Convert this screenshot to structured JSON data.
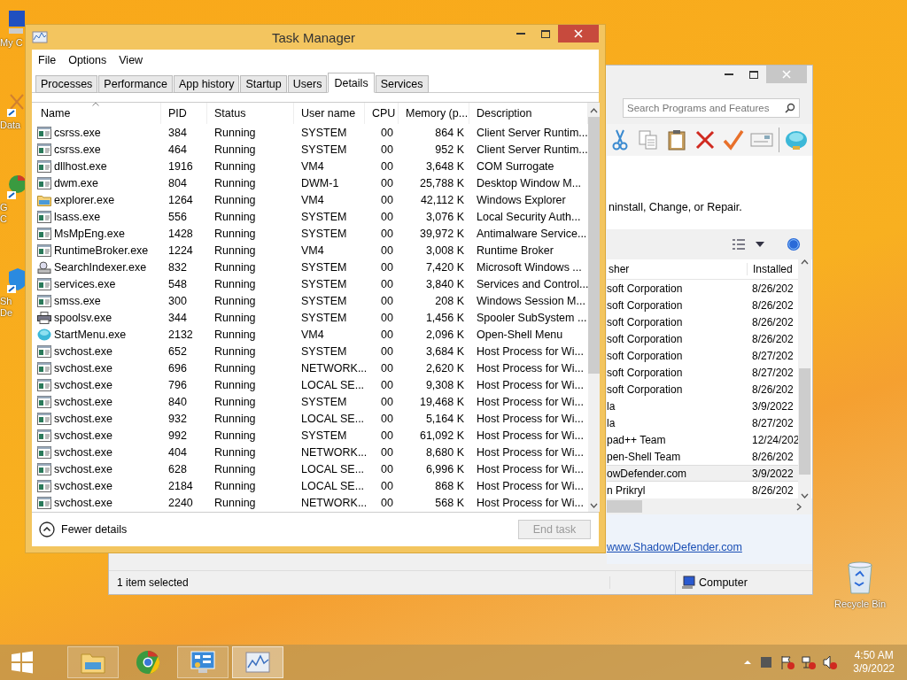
{
  "desktop_icons": [
    {
      "kind": "computer",
      "lines": [
        "My C"
      ]
    },
    {
      "kind": "shortcut",
      "lines": [
        "Data"
      ]
    },
    {
      "kind": "chrome",
      "lines": [
        "G",
        "C"
      ]
    },
    {
      "kind": "shield",
      "lines": [
        "Sh",
        "De"
      ]
    }
  ],
  "recycle_bin": {
    "label": "Recycle Bin"
  },
  "background_window": {
    "search": {
      "placeholder": "Search Programs and Features"
    },
    "instruction": "ninstall, Change, or Repair.",
    "columns": [
      "sher",
      "Installed"
    ],
    "rows": [
      {
        "publisher": "soft Corporation",
        "installed": "8/26/202",
        "selected": false
      },
      {
        "publisher": "soft Corporation",
        "installed": "8/26/202",
        "selected": false
      },
      {
        "publisher": "soft Corporation",
        "installed": "8/26/202",
        "selected": false
      },
      {
        "publisher": "soft Corporation",
        "installed": "8/26/202",
        "selected": false
      },
      {
        "publisher": "soft Corporation",
        "installed": "8/27/202",
        "selected": false
      },
      {
        "publisher": "soft Corporation",
        "installed": "8/27/202",
        "selected": false
      },
      {
        "publisher": "soft Corporation",
        "installed": "8/26/202",
        "selected": false
      },
      {
        "publisher": "la",
        "installed": "3/9/2022",
        "selected": false
      },
      {
        "publisher": "la",
        "installed": "8/27/202",
        "selected": false
      },
      {
        "publisher": "pad++ Team",
        "installed": "12/24/202",
        "selected": false
      },
      {
        "publisher": "pen-Shell Team",
        "installed": "8/26/202",
        "selected": false
      },
      {
        "publisher": "owDefender.com",
        "installed": "3/9/2022",
        "selected": true
      },
      {
        "publisher": "n Prikryl",
        "installed": "8/26/202",
        "selected": false
      }
    ],
    "link": "www.ShadowDefender.com",
    "status_bar": {
      "selection": "1 item selected",
      "location": "Computer"
    }
  },
  "task_manager": {
    "title": "Task Manager",
    "menu": [
      "File",
      "Options",
      "View"
    ],
    "tabs": [
      {
        "label": "Processes",
        "selected": false
      },
      {
        "label": "Performance",
        "selected": false
      },
      {
        "label": "App history",
        "selected": false
      },
      {
        "label": "Startup",
        "selected": false
      },
      {
        "label": "Users",
        "selected": false
      },
      {
        "label": "Details",
        "selected": true
      },
      {
        "label": "Services",
        "selected": false
      }
    ],
    "columns": [
      "Name",
      "PID",
      "Status",
      "User name",
      "CPU",
      "Memory (p...",
      "Description"
    ],
    "rows": [
      {
        "kind": "app",
        "name": "csrss.exe",
        "pid": "384",
        "status": "Running",
        "user": "SYSTEM",
        "cpu": "00",
        "memory": "864 K",
        "description": "Client Server Runtim..."
      },
      {
        "kind": "app",
        "name": "csrss.exe",
        "pid": "464",
        "status": "Running",
        "user": "SYSTEM",
        "cpu": "00",
        "memory": "952 K",
        "description": "Client Server Runtim..."
      },
      {
        "kind": "app",
        "name": "dllhost.exe",
        "pid": "1916",
        "status": "Running",
        "user": "VM4",
        "cpu": "00",
        "memory": "3,648 K",
        "description": "COM Surrogate"
      },
      {
        "kind": "app",
        "name": "dwm.exe",
        "pid": "804",
        "status": "Running",
        "user": "DWM-1",
        "cpu": "00",
        "memory": "25,788 K",
        "description": "Desktop Window M..."
      },
      {
        "kind": "folder",
        "name": "explorer.exe",
        "pid": "1264",
        "status": "Running",
        "user": "VM4",
        "cpu": "00",
        "memory": "42,112 K",
        "description": "Windows Explorer"
      },
      {
        "kind": "app",
        "name": "lsass.exe",
        "pid": "556",
        "status": "Running",
        "user": "SYSTEM",
        "cpu": "00",
        "memory": "3,076 K",
        "description": "Local Security Auth..."
      },
      {
        "kind": "app",
        "name": "MsMpEng.exe",
        "pid": "1428",
        "status": "Running",
        "user": "SYSTEM",
        "cpu": "00",
        "memory": "39,972 K",
        "description": "Antimalware Service..."
      },
      {
        "kind": "app",
        "name": "RuntimeBroker.exe",
        "pid": "1224",
        "status": "Running",
        "user": "VM4",
        "cpu": "00",
        "memory": "3,008 K",
        "description": "Runtime Broker"
      },
      {
        "kind": "search",
        "name": "SearchIndexer.exe",
        "pid": "832",
        "status": "Running",
        "user": "SYSTEM",
        "cpu": "00",
        "memory": "7,420 K",
        "description": "Microsoft Windows ..."
      },
      {
        "kind": "app",
        "name": "services.exe",
        "pid": "548",
        "status": "Running",
        "user": "SYSTEM",
        "cpu": "00",
        "memory": "3,840 K",
        "description": "Services and Control..."
      },
      {
        "kind": "app",
        "name": "smss.exe",
        "pid": "300",
        "status": "Running",
        "user": "SYSTEM",
        "cpu": "00",
        "memory": "208 K",
        "description": "Windows Session M..."
      },
      {
        "kind": "printer",
        "name": "spoolsv.exe",
        "pid": "344",
        "status": "Running",
        "user": "SYSTEM",
        "cpu": "00",
        "memory": "1,456 K",
        "description": "Spooler SubSystem ..."
      },
      {
        "kind": "shell",
        "name": "StartMenu.exe",
        "pid": "2132",
        "status": "Running",
        "user": "VM4",
        "cpu": "00",
        "memory": "2,096 K",
        "description": "Open-Shell Menu"
      },
      {
        "kind": "app",
        "name": "svchost.exe",
        "pid": "652",
        "status": "Running",
        "user": "SYSTEM",
        "cpu": "00",
        "memory": "3,684 K",
        "description": "Host Process for Wi..."
      },
      {
        "kind": "app",
        "name": "svchost.exe",
        "pid": "696",
        "status": "Running",
        "user": "NETWORK...",
        "cpu": "00",
        "memory": "2,620 K",
        "description": "Host Process for Wi..."
      },
      {
        "kind": "app",
        "name": "svchost.exe",
        "pid": "796",
        "status": "Running",
        "user": "LOCAL SE...",
        "cpu": "00",
        "memory": "9,308 K",
        "description": "Host Process for Wi..."
      },
      {
        "kind": "app",
        "name": "svchost.exe",
        "pid": "840",
        "status": "Running",
        "user": "SYSTEM",
        "cpu": "00",
        "memory": "19,468 K",
        "description": "Host Process for Wi..."
      },
      {
        "kind": "app",
        "name": "svchost.exe",
        "pid": "932",
        "status": "Running",
        "user": "LOCAL SE...",
        "cpu": "00",
        "memory": "5,164 K",
        "description": "Host Process for Wi..."
      },
      {
        "kind": "app",
        "name": "svchost.exe",
        "pid": "992",
        "status": "Running",
        "user": "SYSTEM",
        "cpu": "00",
        "memory": "61,092 K",
        "description": "Host Process for Wi..."
      },
      {
        "kind": "app",
        "name": "svchost.exe",
        "pid": "404",
        "status": "Running",
        "user": "NETWORK...",
        "cpu": "00",
        "memory": "8,680 K",
        "description": "Host Process for Wi..."
      },
      {
        "kind": "app",
        "name": "svchost.exe",
        "pid": "628",
        "status": "Running",
        "user": "LOCAL SE...",
        "cpu": "00",
        "memory": "6,996 K",
        "description": "Host Process for Wi..."
      },
      {
        "kind": "app",
        "name": "svchost.exe",
        "pid": "2184",
        "status": "Running",
        "user": "LOCAL SE...",
        "cpu": "00",
        "memory": "868 K",
        "description": "Host Process for Wi..."
      },
      {
        "kind": "app",
        "name": "svchost.exe",
        "pid": "2240",
        "status": "Running",
        "user": "NETWORK...",
        "cpu": "00",
        "memory": "568 K",
        "description": "Host Process for Wi..."
      }
    ],
    "fewer_details": "Fewer details",
    "end_task": {
      "label": "End task",
      "disabled": true
    }
  },
  "taskbar": {
    "apps": [
      {
        "kind": "explorer",
        "running": true,
        "active": false
      },
      {
        "kind": "chrome",
        "running": false,
        "active": false
      },
      {
        "kind": "control",
        "running": true,
        "active": false
      },
      {
        "kind": "taskmgr",
        "running": true,
        "active": true
      }
    ],
    "clock": {
      "time": "4:50 AM",
      "date": "3/9/2022"
    }
  }
}
